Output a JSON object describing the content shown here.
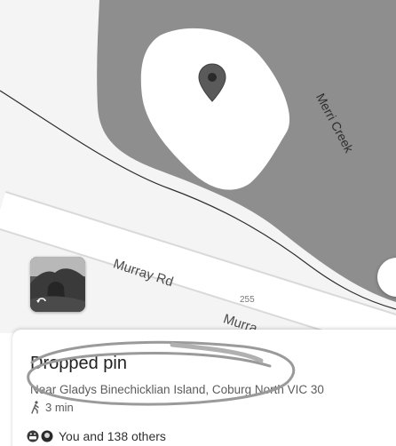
{
  "map": {
    "road_labels": [
      "Murray Rd",
      "Murra"
    ],
    "route_number": "255",
    "creek_label": "Merri Creek",
    "icons": [
      "map-pin-icon",
      "street-view-icon"
    ]
  },
  "place_card": {
    "title": "Dropped pin",
    "address": "Near Gladys Binechicklian Island, Coburg North VIC 30",
    "walk_time": "3 min",
    "walk_icon": "walking-person-icon"
  },
  "social": {
    "text": "You and 138 others",
    "icons": [
      "grinning-face-icon",
      "face-icon"
    ]
  },
  "colors": {
    "water": "#8e8e8e",
    "land": "#f4f4f4",
    "island": "#ffffff",
    "pin": "#5a5a5a"
  }
}
